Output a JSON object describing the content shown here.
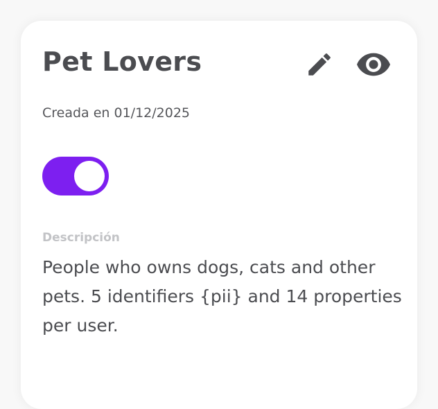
{
  "card": {
    "title": "Pet Lovers",
    "created_label": "Creada en 01/12/2025",
    "toggle": {
      "state": "on",
      "color": "#7d1ff0"
    },
    "description_label": "Descripción",
    "description": "People who owns dogs, cats and other pets. 5 identifiers {pii} and 14 properties per user."
  },
  "actions": {
    "edit_icon": "pencil-icon",
    "view_icon": "eye-icon",
    "icon_color": "#4b4c50"
  }
}
